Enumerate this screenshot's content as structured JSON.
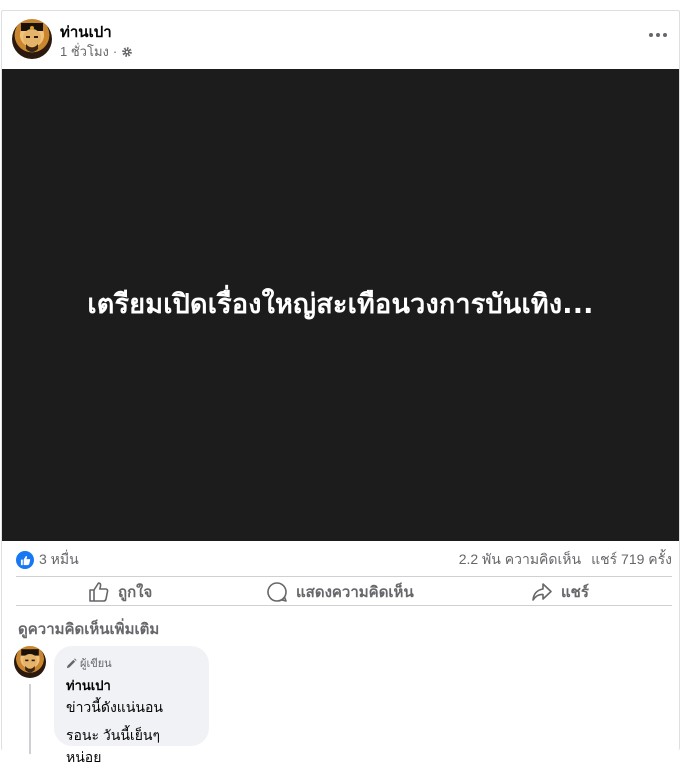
{
  "post": {
    "author": "ท่านเปา",
    "time": "1 ชั่วโมง",
    "separator": "·",
    "audience_icon": "gear-icon",
    "image_text": "เตรียมเปิดเรื่องใหญ่สะเทือนวงการบันเทิง..."
  },
  "stats": {
    "reactions": "3 หมื่น",
    "comments": "2.2 พัน ความคิดเห็น",
    "shares": "แชร์ 719 ครั้ง"
  },
  "actions": {
    "like": "ถูกใจ",
    "comment": "แสดงความคิดเห็น",
    "share": "แชร์"
  },
  "comments_section": {
    "more_label": "ดูความคิดเห็นเพิ่มเติม",
    "items": [
      {
        "badge": "ผู้เขียน",
        "name": "ท่านเปา",
        "line1": "ข่าวนี้ดังแน่นอน",
        "line2": "รอนะ วันนี้เย็นๆ หน่อย"
      }
    ]
  },
  "colors": {
    "brand_blue": "#1877f2",
    "media_bg": "#1c1c1c",
    "muted_text": "#65676b"
  }
}
